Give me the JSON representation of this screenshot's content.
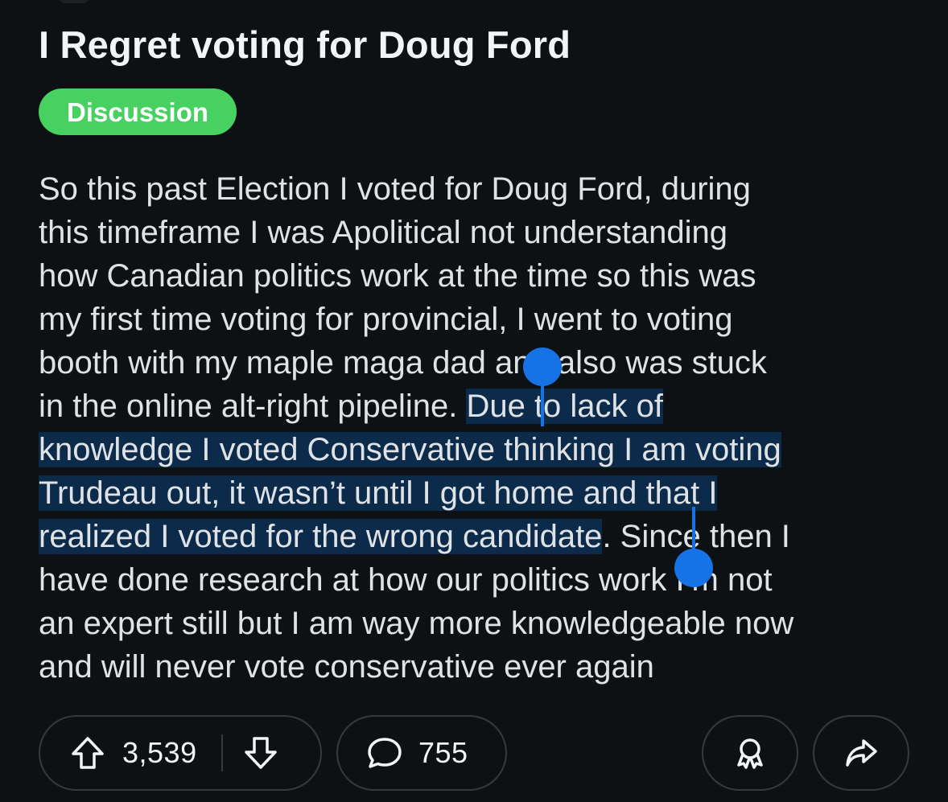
{
  "post": {
    "title": "I Regret voting for Doug Ford",
    "flair": "Discussion",
    "flair_color": "#46d160",
    "body_lines": [
      {
        "text": "So this past Election I voted for Doug Ford, during"
      },
      {
        "text": "this timeframe I was Apolitical not understanding"
      },
      {
        "text": "how Canadian politics work at the time so this was"
      },
      {
        "text": "my first time voting for provincial, I went to voting"
      },
      {
        "text": "booth with my maple maga dad and also was stuck"
      },
      {
        "before": "in the online alt-right pipeline. ",
        "selected": "Due to lack of"
      },
      {
        "selected": "knowledge I voted Conservative thinking I am voting"
      },
      {
        "selected": "Trudeau out, it wasn’t until I got home and that I"
      },
      {
        "selected": "realized I voted for the wrong candidate",
        "after": ". Since then I"
      },
      {
        "text": "have done research at how our politics work I’m not"
      },
      {
        "text": "an expert still but I am way more knowledgeable now"
      },
      {
        "text": "and will never vote conservative ever again"
      }
    ]
  },
  "selection": {
    "highlight_color": "#0c2a4a",
    "handle_color": "#1673e6"
  },
  "actions": {
    "upvotes": "3,539",
    "comments": "755",
    "icons": {
      "upvote": "upvote-arrow-icon",
      "downvote": "downvote-arrow-icon",
      "comment": "comment-bubble-icon",
      "award": "award-icon",
      "share": "share-arrow-icon"
    }
  }
}
